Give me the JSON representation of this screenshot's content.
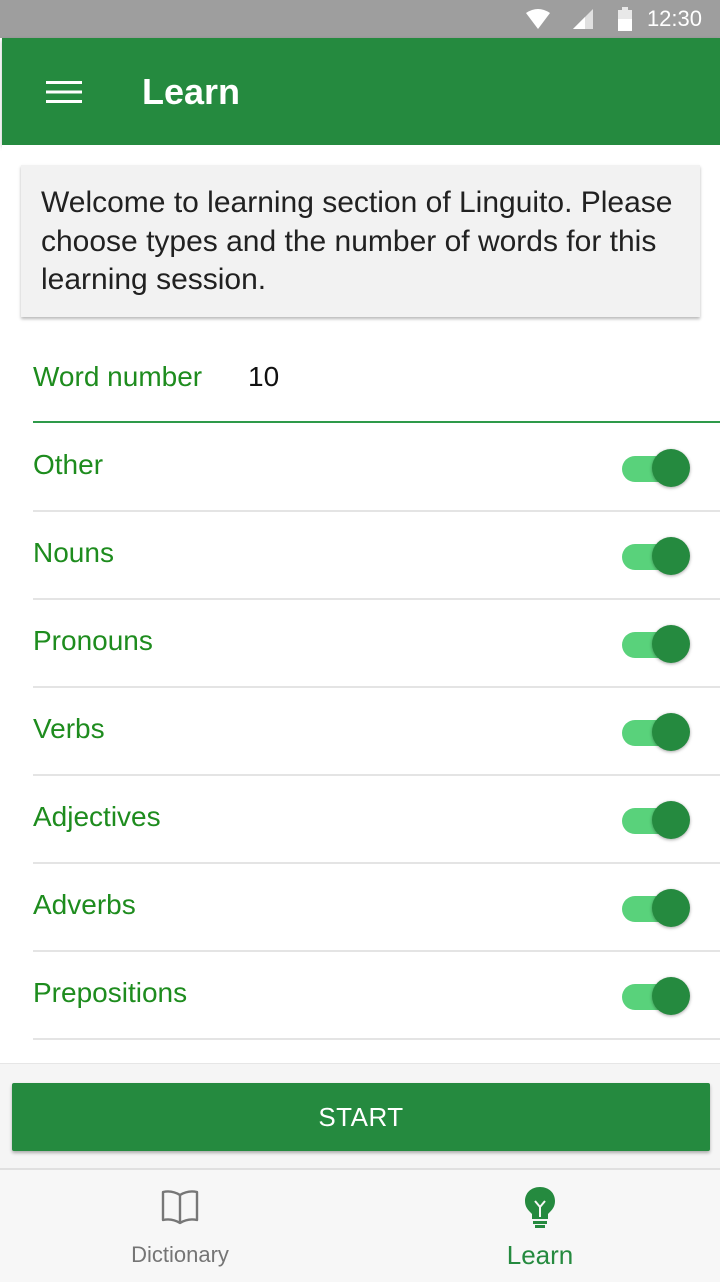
{
  "status_bar": {
    "time": "12:30"
  },
  "app_bar": {
    "title": "Learn"
  },
  "welcome": {
    "text": "Welcome to learning section of Linguito. Please choose types and the number of words for this learning session."
  },
  "word_number": {
    "label": "Word number",
    "value": "10"
  },
  "types": [
    {
      "label": "Other",
      "enabled": true
    },
    {
      "label": "Nouns",
      "enabled": true
    },
    {
      "label": "Pronouns",
      "enabled": true
    },
    {
      "label": "Verbs",
      "enabled": true
    },
    {
      "label": "Adjectives",
      "enabled": true
    },
    {
      "label": "Adverbs",
      "enabled": true
    },
    {
      "label": "Prepositions",
      "enabled": true
    }
  ],
  "start_button": {
    "label": "START"
  },
  "bottom_nav": {
    "dictionary": {
      "label": "Dictionary",
      "icon": "book-icon"
    },
    "learn": {
      "label": "Learn",
      "icon": "lightbulb-icon",
      "active": true
    }
  },
  "colors": {
    "primary": "#258a3f",
    "accent_text": "#1e8c1e",
    "toggle_track": "#59d27b"
  }
}
